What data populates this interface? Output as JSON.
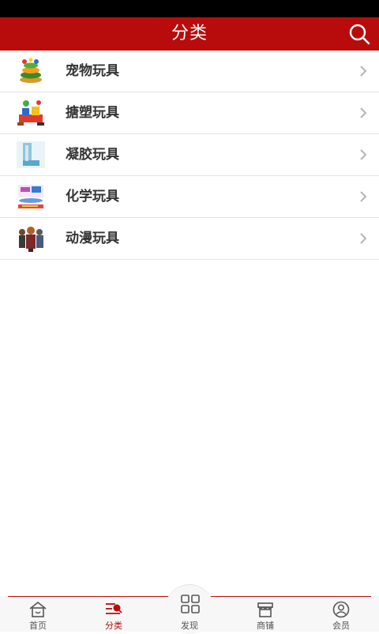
{
  "header": {
    "title": "分类",
    "search_icon": "search-icon"
  },
  "categories": [
    {
      "label": "宠物玩具",
      "thumb": "pet-toy-thumbnail"
    },
    {
      "label": "搪塑玩具",
      "thumb": "rotomold-toy-thumbnail"
    },
    {
      "label": "凝胶玩具",
      "thumb": "gel-toy-thumbnail"
    },
    {
      "label": "化学玩具",
      "thumb": "chemistry-toy-thumbnail"
    },
    {
      "label": "动漫玩具",
      "thumb": "anime-toy-thumbnail"
    }
  ],
  "tabbar": {
    "home": "首页",
    "category": "分类",
    "discover": "发现",
    "shop": "商铺",
    "member": "会员"
  },
  "colors": {
    "brand": "#b80c0c",
    "text": "#333333",
    "divider": "#e5e5e5"
  }
}
